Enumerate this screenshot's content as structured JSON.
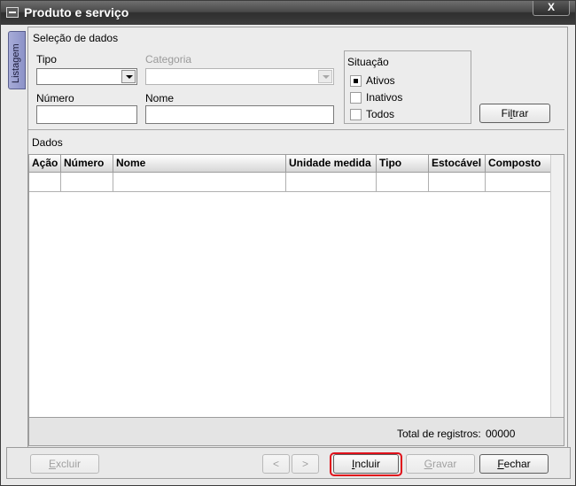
{
  "window": {
    "title": "Produto e serviço",
    "close_label": "X"
  },
  "sidetab": {
    "label": "Listagem"
  },
  "selection": {
    "group_title": "Seleção de dados",
    "tipo_label": "Tipo",
    "tipo_value": "",
    "categoria_label": "Categoria",
    "categoria_value": "",
    "numero_label": "Número",
    "numero_value": "",
    "nome_label": "Nome",
    "nome_value": "",
    "situacao": {
      "title": "Situação",
      "options": [
        {
          "label": "Ativos",
          "checked": true
        },
        {
          "label": "Inativos",
          "checked": false
        },
        {
          "label": "Todos",
          "checked": false
        }
      ]
    },
    "filter_button_pre": "Fi",
    "filter_button_mnemonic": "l",
    "filter_button_post": "trar"
  },
  "data_section": {
    "title": "Dados",
    "columns": [
      "Ação",
      "Número",
      "Nome",
      "Unidade medida",
      "Tipo",
      "Estocável",
      "Composto"
    ],
    "rows": [
      [
        "",
        "",
        "",
        "",
        "",
        "",
        ""
      ]
    ],
    "total_label": "Total de registros:",
    "total_value": "00000"
  },
  "buttons": {
    "excluir": {
      "mnemonic": "E",
      "rest": "xcluir",
      "enabled": false
    },
    "prev": {
      "label": "<",
      "enabled": false
    },
    "next": {
      "label": ">",
      "enabled": false
    },
    "incluir": {
      "mnemonic": "I",
      "rest": "ncluir",
      "enabled": true
    },
    "gravar": {
      "mnemonic": "G",
      "rest": "ravar",
      "enabled": false
    },
    "fechar": {
      "mnemonic": "F",
      "rest": "echar",
      "enabled": true
    }
  },
  "colors": {
    "titlebar": "#3d3d3d",
    "sidetab": "#9aa0d0",
    "highlight": "#e0101a"
  }
}
